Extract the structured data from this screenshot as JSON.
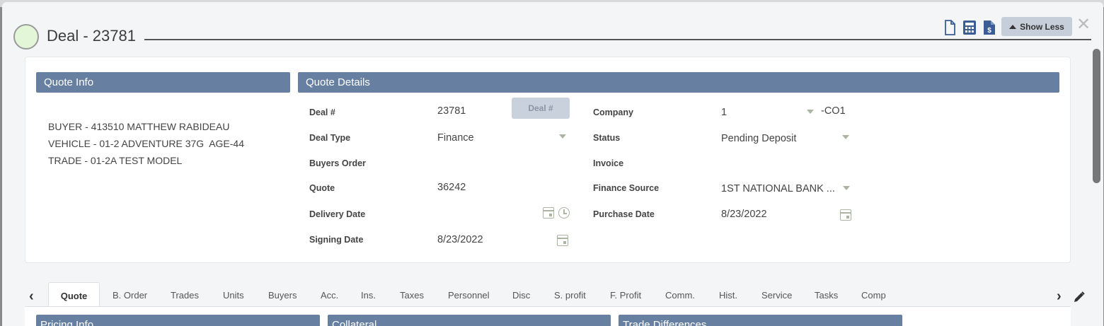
{
  "header": {
    "title": "Deal - 23781",
    "show_less_label": "Show Less",
    "icons": [
      "document-icon",
      "calculator-icon",
      "invoice-dollar-icon"
    ]
  },
  "quote_info": {
    "heading": "Quote Info",
    "lines": [
      "BUYER - 413510 MATTHEW RABIDEAU",
      "VEHICLE - 01-2 ADVENTURE 37G  AGE-44",
      "TRADE - 01-2A TEST MODEL"
    ]
  },
  "quote_details": {
    "heading": "Quote Details",
    "deal_number_label": "Deal #",
    "deal_number_value": "23781",
    "deal_button_label": "Deal #",
    "deal_type_label": "Deal Type",
    "deal_type_value": "Finance",
    "buyers_order_label": "Buyers Order",
    "quote_label": "Quote",
    "quote_value": "36242",
    "delivery_date_label": "Delivery Date",
    "signing_date_label": "Signing Date",
    "signing_date_value": "8/23/2022",
    "company_label": "Company",
    "company_value": "1",
    "company_suffix": "-CO1",
    "status_label": "Status",
    "status_value": "Pending Deposit",
    "invoice_label": "Invoice",
    "finance_source_label": "Finance Source",
    "finance_source_value": "1ST NATIONAL BANK ...",
    "purchase_date_label": "Purchase Date",
    "purchase_date_value": "8/23/2022"
  },
  "tabs": {
    "active": "Quote",
    "items": [
      "B. Order",
      "Trades",
      "Units",
      "Buyers",
      "Acc.",
      "Ins.",
      "Taxes",
      "Personnel",
      "Disc",
      "S. profit",
      "F. Profit",
      "Comm.",
      "Hist.",
      "Service",
      "Tasks",
      "Comp"
    ]
  },
  "bottom_panels": [
    "Pricing Info",
    "Collateral",
    "Trade Differences"
  ],
  "colors": {
    "panel_header": "#6780a2",
    "show_less_bg": "#c6ced9",
    "status_circle": "#e3f7d8"
  }
}
